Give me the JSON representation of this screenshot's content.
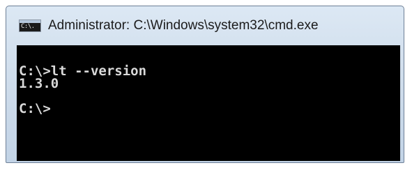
{
  "window": {
    "title": "Administrator: C:\\Windows\\system32\\cmd.exe",
    "icon": "cmd-window-icon",
    "icon_label": "C:\\."
  },
  "console": {
    "lines": [
      "C:\\>lt --version",
      "1.3.0",
      "",
      "C:\\>"
    ]
  },
  "colors": {
    "console_background": "#000000",
    "console_text": "#d9d9d9",
    "titlebar": "#cddbea"
  }
}
